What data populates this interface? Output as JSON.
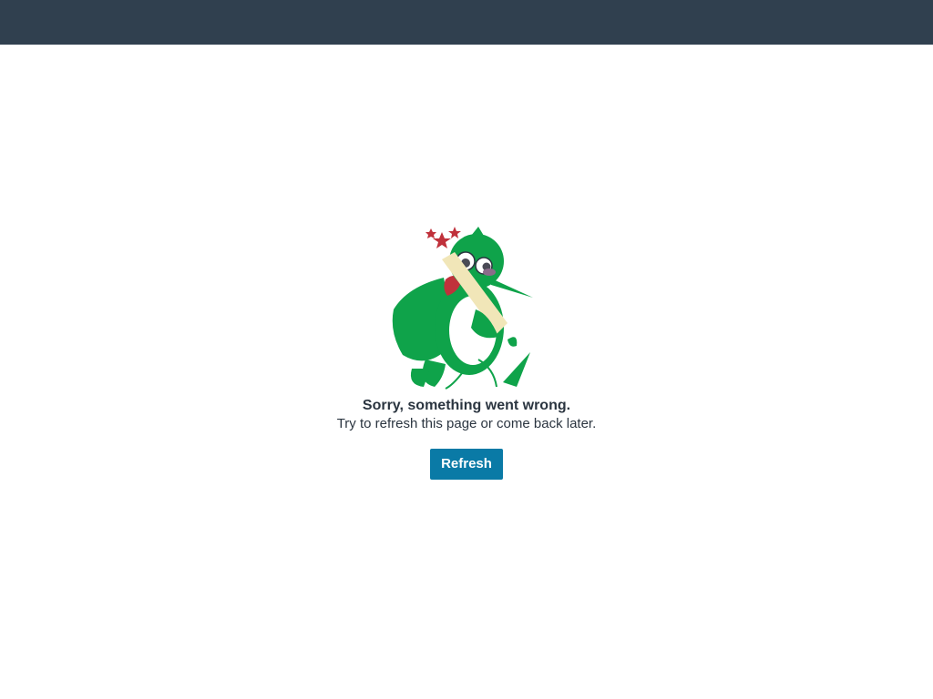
{
  "header": {
    "background_color": "#30404f"
  },
  "error": {
    "illustration_icon": "dazed-hummingbird-icon",
    "title": "Sorry, something went wrong.",
    "message": "Try to refresh this page or come back later.",
    "refresh_label": "Refresh"
  },
  "colors": {
    "button": "#0a7aa6",
    "bird_green": "#0fa34a",
    "stars": "#c0313b",
    "text": "#2b3540"
  }
}
